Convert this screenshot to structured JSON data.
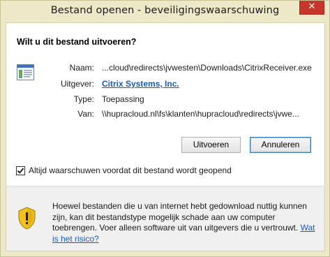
{
  "window": {
    "title": "Bestand openen - beveiligingswaarschuwing",
    "close_glyph": "✕"
  },
  "dialog": {
    "question": "Wilt u dit bestand uitvoeren?",
    "file_icon": "application-window-icon",
    "fields": [
      {
        "label": "Naam:",
        "value": "...cloud\\redirects\\jvwesten\\Downloads\\CitrixReceiver.exe"
      },
      {
        "label": "Uitgever:",
        "value": "Citrix Systems, Inc."
      },
      {
        "label": "Type:",
        "value": "Toepassing"
      },
      {
        "label": "Van:",
        "value": "\\\\hupracloud.nl\\fs\\klanten\\hupracloud\\redirects\\jvwe..."
      }
    ],
    "buttons": {
      "run": "Uitvoeren",
      "cancel": "Annuleren"
    },
    "checkbox": {
      "checked": true,
      "label": "Altijd waarschuwen voordat dit bestand wordt geopend"
    }
  },
  "warning": {
    "icon": "warning-shield-icon",
    "text": "Hoewel bestanden die u van internet hebt gedownload nuttig kunnen zijn, kan dit bestandstype mogelijk schade aan uw computer toebrengen. Voer alleen software uit van uitgevers die u vertrouwt.",
    "link": "Wat is het risico?"
  },
  "colors": {
    "titlebar": "#ede8c8",
    "close_button": "#c7352b",
    "link": "#1a5ab3",
    "shield_yellow": "#f2c21b"
  }
}
